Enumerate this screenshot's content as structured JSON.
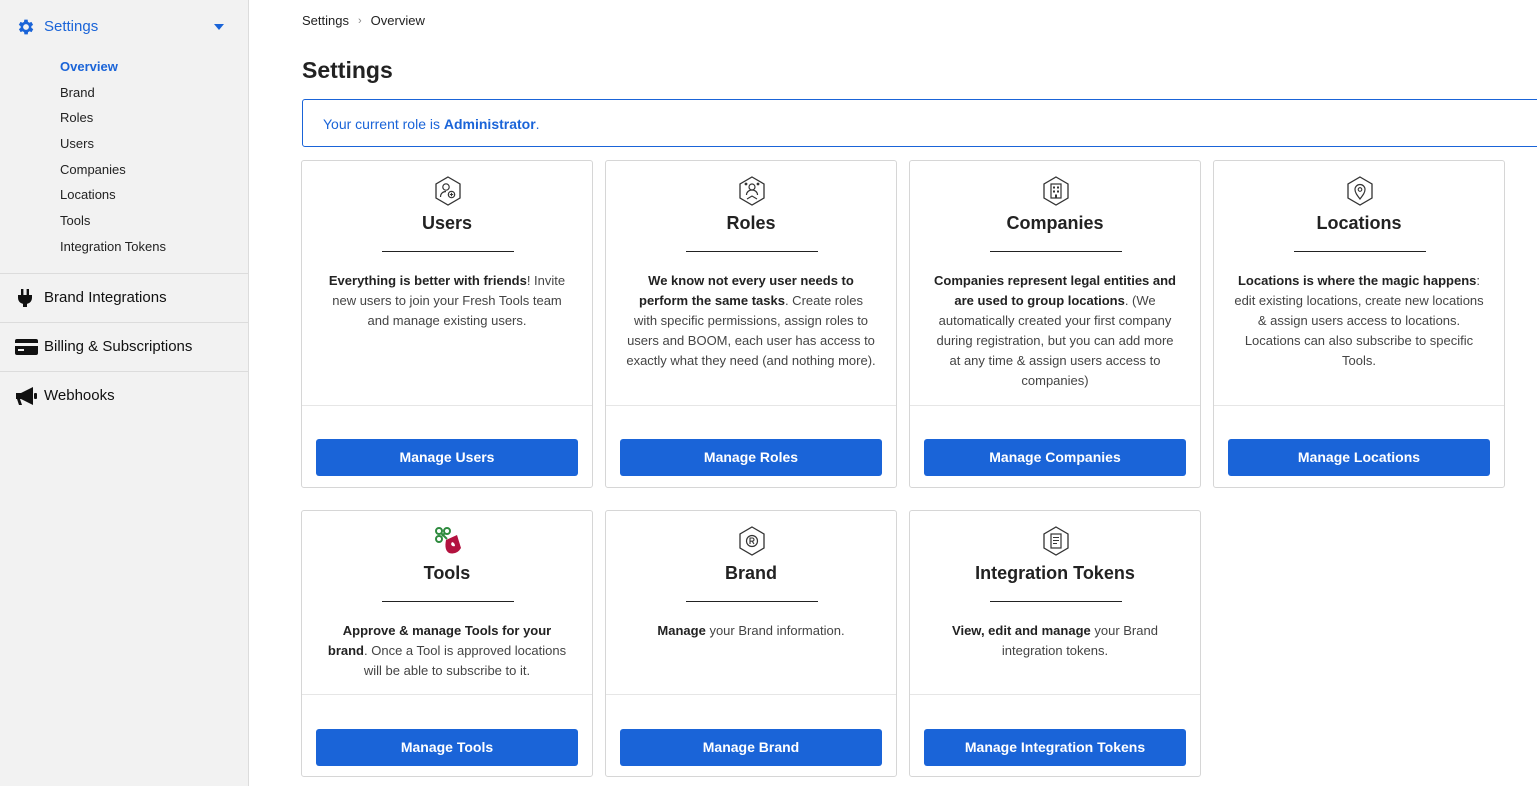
{
  "sidebar": {
    "settings_label": "Settings",
    "sub_items": [
      "Overview",
      "Brand",
      "Roles",
      "Users",
      "Companies",
      "Locations",
      "Tools",
      "Integration Tokens"
    ],
    "main_items": [
      "Brand Integrations",
      "Billing & Subscriptions",
      "Webhooks"
    ]
  },
  "breadcrumb": {
    "root": "Settings",
    "current": "Overview"
  },
  "page": {
    "title": "Settings",
    "role_prefix": "Your current role is ",
    "role_name": "Administrator",
    "role_suffix": "."
  },
  "cards": [
    {
      "title": "Users",
      "desc_bold": "Everything is better with friends",
      "desc_rest": "! Invite new users to join your Fresh Tools team and manage existing users.",
      "button": "Manage Users",
      "icon": "user-add-icon"
    },
    {
      "title": "Roles",
      "desc_bold": "We know not every user needs to perform the same tasks",
      "desc_rest": ". Create roles with specific permissions, assign roles to users and BOOM, each user has access to exactly what they need (and nothing more).",
      "button": "Manage Roles",
      "icon": "roles-icon"
    },
    {
      "title": "Companies",
      "desc_bold": "Companies represent legal entities and are used to group locations",
      "desc_rest": ". (We automatically created your first company during registration, but you can add more at any time & assign users access to companies)",
      "button": "Manage Companies",
      "icon": "building-icon"
    },
    {
      "title": "Locations",
      "desc_bold": "Locations is where the magic happens",
      "desc_rest": ": edit existing locations, create new locations & assign users access to locations. Locations can also subscribe to specific Tools.",
      "button": "Manage Locations",
      "icon": "location-pin-icon"
    },
    {
      "title": "Tools",
      "desc_bold": "Approve & manage Tools for your brand",
      "desc_rest": ". Once a Tool is approved locations will be able to subscribe to it.",
      "button": "Manage Tools",
      "icon": "tools-logo-icon"
    },
    {
      "title": "Brand",
      "desc_bold": "Manage",
      "desc_rest": " your Brand information.",
      "button": "Manage Brand",
      "icon": "registered-mark-icon"
    },
    {
      "title": "Integration Tokens",
      "desc_bold": "View, edit and manage",
      "desc_rest": " your Brand integration tokens.",
      "button": "Manage Integration Tokens",
      "icon": "token-document-icon"
    }
  ],
  "colors": {
    "accent": "#1a64d8",
    "tools_red": "#b3123f",
    "tools_green": "#2e8b3e"
  }
}
